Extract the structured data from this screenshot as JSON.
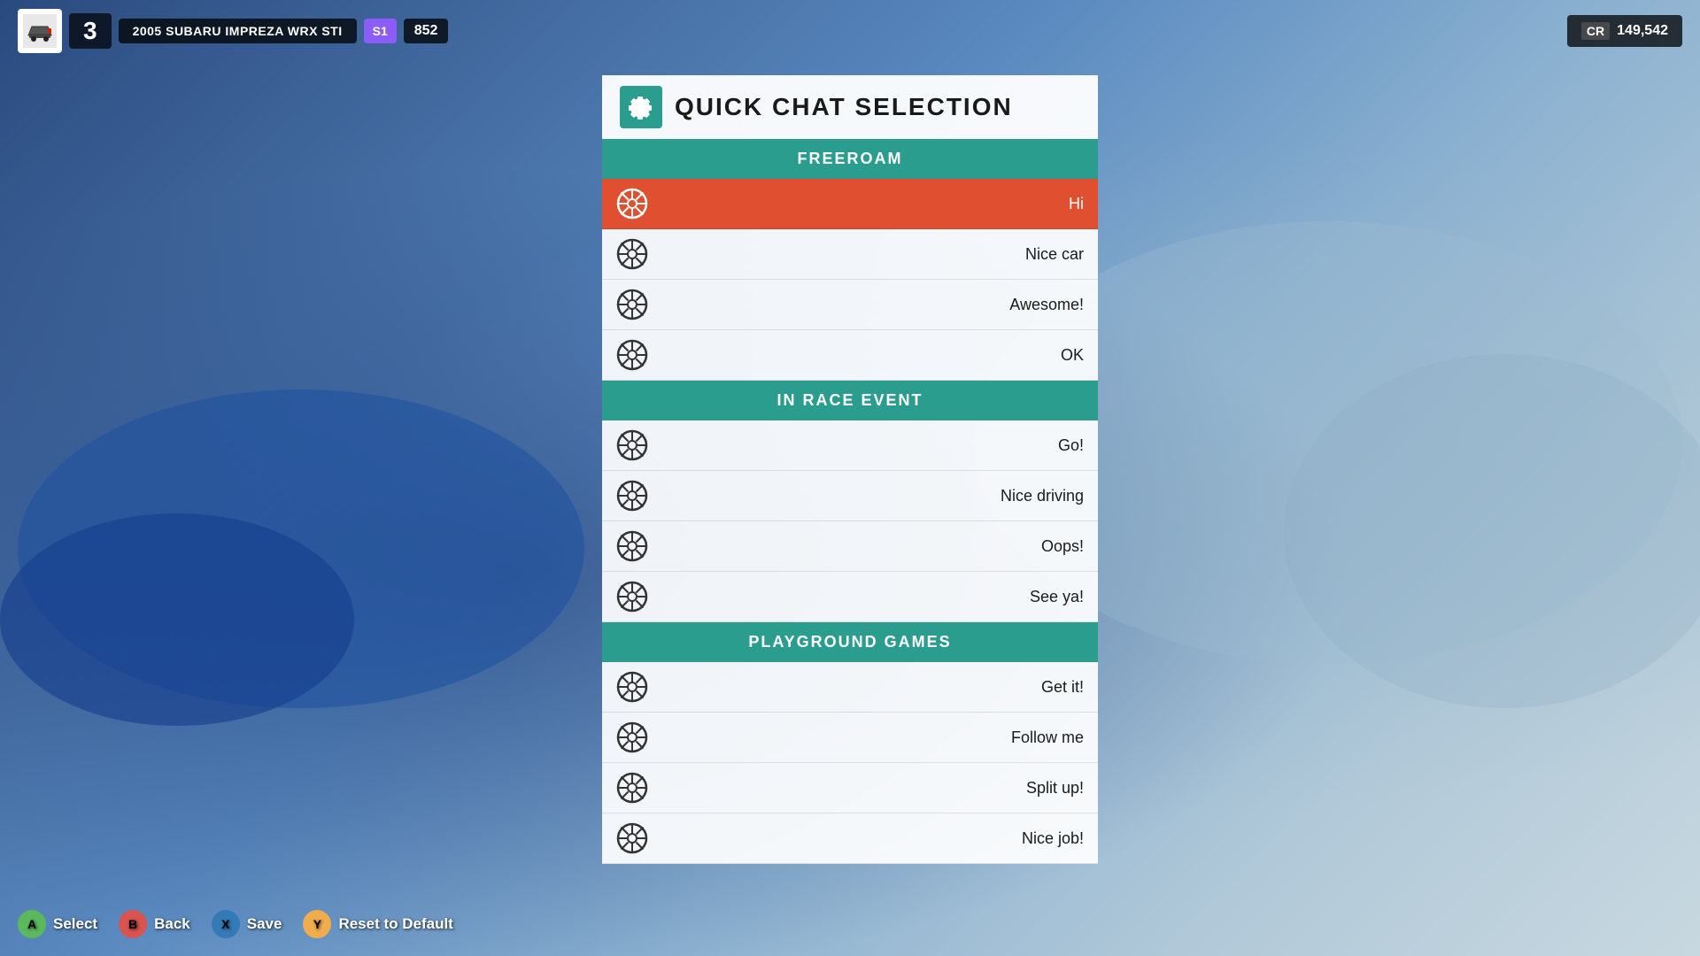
{
  "background": {
    "color": "#4a6fa5"
  },
  "hud": {
    "position": "3",
    "car_make": "2005 SUBARU",
    "car_model": "IMPREZA WRX STI",
    "class": "S1",
    "pi": "852",
    "cr_label": "CR",
    "cr_value": "149,542"
  },
  "panel": {
    "title": "QUICK CHAT SELECTION",
    "sections": [
      {
        "label": "FREEROAM",
        "items": [
          {
            "text": "Hi",
            "selected": true
          },
          {
            "text": "Nice car",
            "selected": false
          },
          {
            "text": "Awesome!",
            "selected": false
          },
          {
            "text": "OK",
            "selected": false
          }
        ]
      },
      {
        "label": "IN RACE EVENT",
        "items": [
          {
            "text": "Go!",
            "selected": false
          },
          {
            "text": "Nice driving",
            "selected": false
          },
          {
            "text": "Oops!",
            "selected": false
          },
          {
            "text": "See ya!",
            "selected": false
          }
        ]
      },
      {
        "label": "PLAYGROUND GAMES",
        "items": [
          {
            "text": "Get it!",
            "selected": false
          },
          {
            "text": "Follow me",
            "selected": false
          },
          {
            "text": "Split up!",
            "selected": false
          },
          {
            "text": "Nice job!",
            "selected": false
          }
        ]
      }
    ]
  },
  "controls": [
    {
      "button": "A",
      "color": "btn-a",
      "label": "Select"
    },
    {
      "button": "B",
      "color": "btn-b",
      "label": "Back"
    },
    {
      "button": "X",
      "color": "btn-x",
      "label": "Save"
    },
    {
      "button": "Y",
      "color": "btn-y",
      "label": "Reset to Default"
    }
  ]
}
